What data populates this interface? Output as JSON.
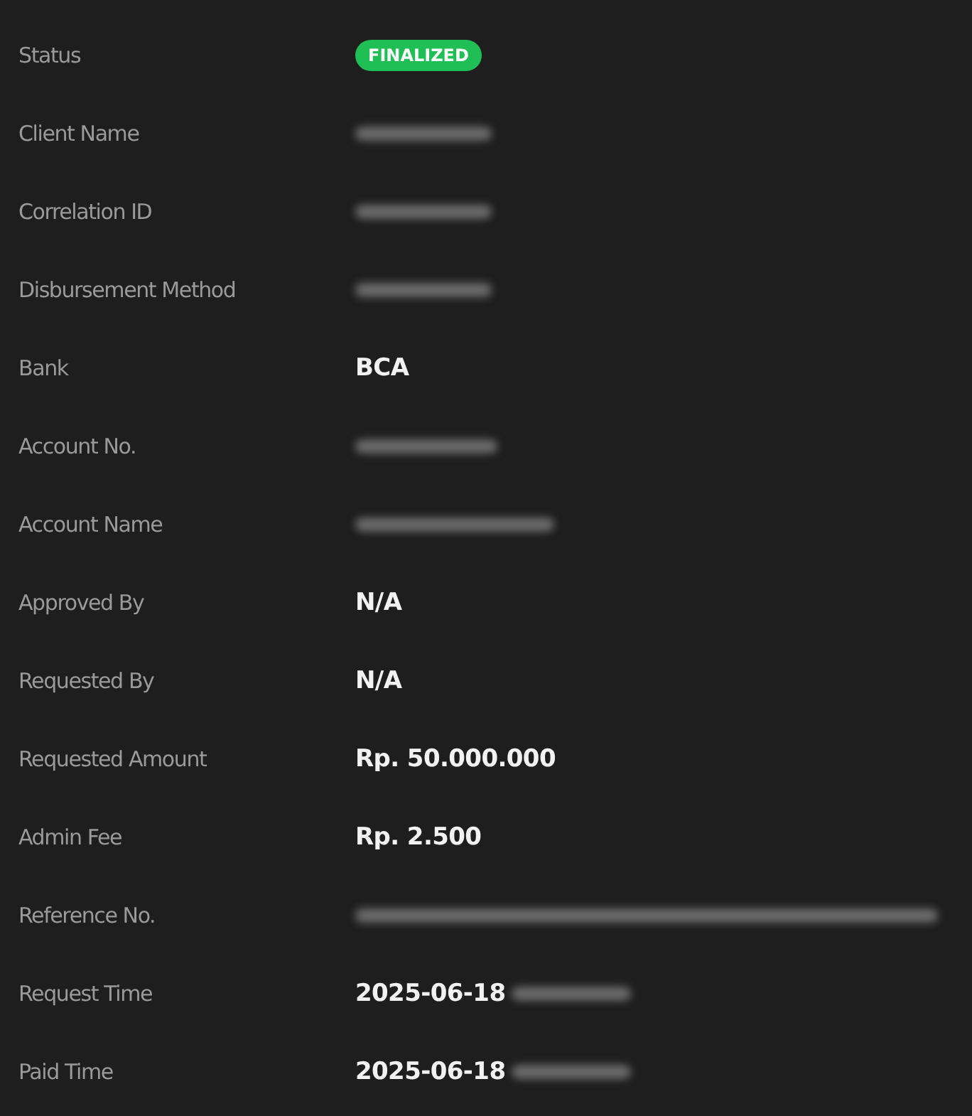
{
  "rows": [
    {
      "label": "Status",
      "badge": "FINALIZED",
      "redacted": false
    },
    {
      "label": "Client Name",
      "redacted": true
    },
    {
      "label": "Correlation ID",
      "redacted": true
    },
    {
      "label": "Disbursement Method",
      "redacted": true
    },
    {
      "label": "Bank",
      "value": "BCA",
      "redacted": false
    },
    {
      "label": "Account No.",
      "redacted": true
    },
    {
      "label": "Account Name",
      "redacted": true
    },
    {
      "label": "Approved By",
      "value": "N/A",
      "redacted": false
    },
    {
      "label": "Requested By",
      "value": "N/A",
      "redacted": false
    },
    {
      "label": "Requested Amount",
      "value": "Rp. 50.000.000",
      "redacted": false
    },
    {
      "label": "Admin Fee",
      "value": "Rp. 2.500",
      "redacted": false
    },
    {
      "label": "Reference No.",
      "redacted": true
    },
    {
      "label": "Request Time",
      "value": "2025-06-18",
      "redacted": true
    },
    {
      "label": "Paid Time",
      "value": "2025-06-18",
      "redacted": true
    }
  ]
}
